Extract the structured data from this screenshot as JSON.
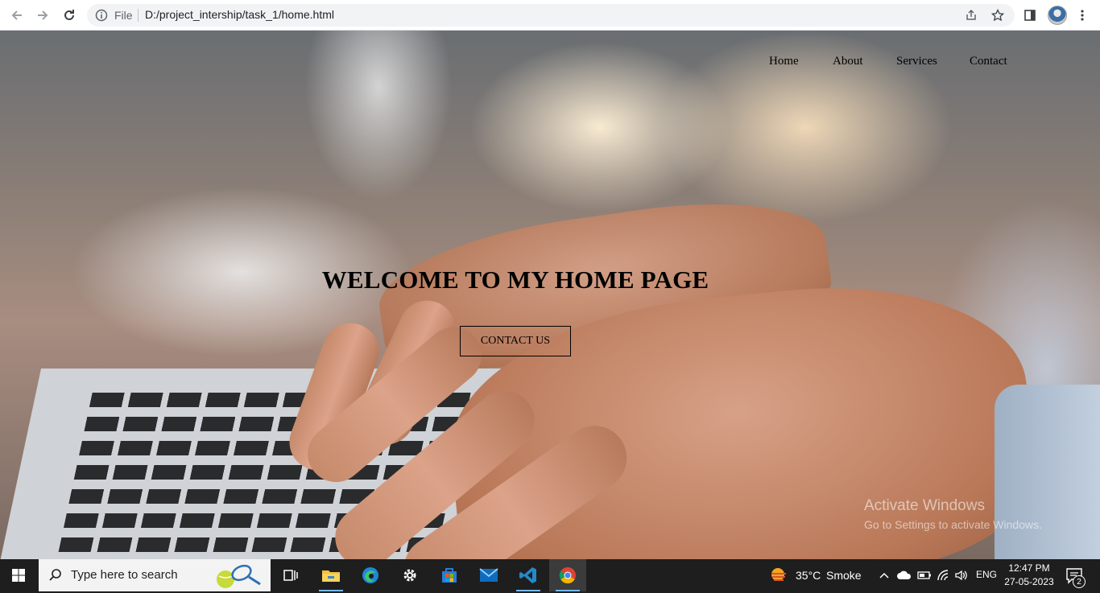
{
  "browser": {
    "url_scheme_label": "File",
    "url": "D:/project_intership/task_1/home.html",
    "icons": [
      "back-icon",
      "forward-icon",
      "reload-icon",
      "info-icon",
      "share-icon",
      "star-icon",
      "side-panel-icon",
      "profile-avatar",
      "menu-icon"
    ]
  },
  "site": {
    "nav": {
      "home": "Home",
      "about": "About",
      "services": "Services",
      "contact": "Contact"
    },
    "hero": {
      "title": "WELCOME TO MY HOME PAGE",
      "button": "CONTACT US"
    }
  },
  "watermark": {
    "title": "Activate Windows",
    "subtitle": "Go to Settings to activate Windows."
  },
  "taskbar": {
    "search_placeholder": "Type here to search",
    "apps": [
      "task-view",
      "file-explorer",
      "edge",
      "settings",
      "microsoft-store",
      "mail",
      "vscode",
      "chrome"
    ],
    "weather": {
      "temp": "35°C",
      "condition": "Smoke"
    },
    "language": "ENG",
    "time": "12:47 PM",
    "date": "27-05-2023",
    "notification_count": "2"
  },
  "colors": {
    "taskbar": "#1e1e1e",
    "browser_bar": "#ffffff",
    "accent_underline": "#76b9ed"
  }
}
